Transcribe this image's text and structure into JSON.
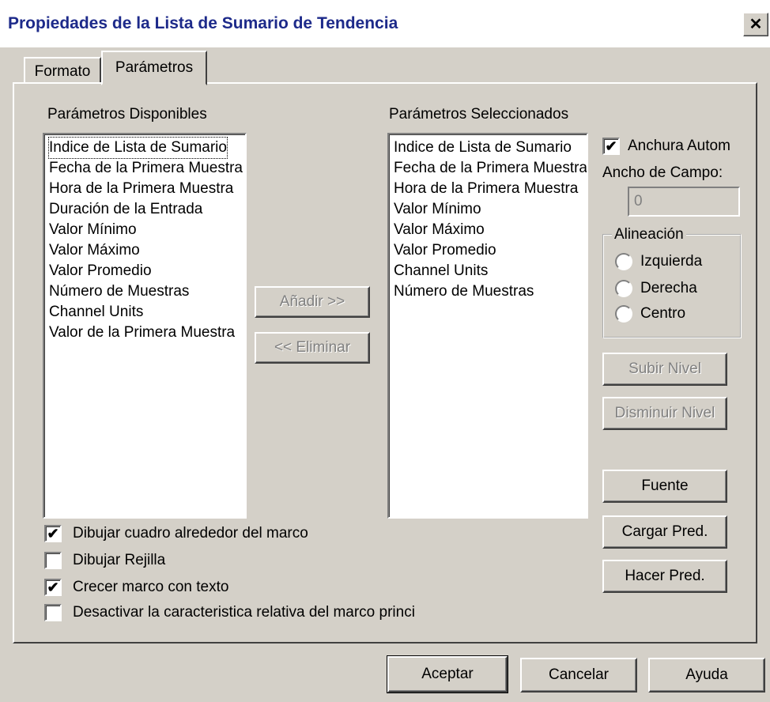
{
  "window": {
    "title": "Propiedades de la Lista de Sumario de Tendencia",
    "close_glyph": "✕"
  },
  "tabs": [
    {
      "label": "Formato"
    },
    {
      "label": "Parámetros"
    }
  ],
  "available": {
    "label": "Parámetros Disponibles",
    "items": [
      "Indice de Lista de Sumario",
      "Fecha de la Primera Muestra",
      "Hora de la Primera Muestra",
      "Duración de la Entrada",
      "Valor Mínimo",
      "Valor Máximo",
      "Valor Promedio",
      "Número de Muestras",
      "Channel Units",
      "Valor de la Primera Muestra"
    ]
  },
  "selected": {
    "label": "Parámetros Seleccionados",
    "items": [
      "Indice de Lista de Sumario",
      "Fecha de la Primera Muestra",
      "Hora de la Primera Muestra",
      "Valor Mínimo",
      "Valor Máximo",
      "Valor Promedio",
      "Channel Units",
      "Número de Muestras"
    ]
  },
  "buttons": {
    "add": "Añadir >>",
    "remove": "<< Eliminar",
    "move_up": "Subir Nivel",
    "move_down": "Disminuir Nivel",
    "font": "Fuente",
    "load_default": "Cargar Pred.",
    "make_default": "Hacer Pred.",
    "ok": "Aceptar",
    "cancel": "Cancelar",
    "help": "Ayuda"
  },
  "auto_width": {
    "label": "Anchura Autom",
    "checked": true
  },
  "field_width": {
    "label": "Ancho de Campo:",
    "value": "0"
  },
  "alignment": {
    "label": "Alineación",
    "options": [
      "Izquierda",
      "Derecha",
      "Centro"
    ]
  },
  "checkboxes": [
    {
      "label": "Dibujar cuadro alrededor del marco",
      "checked": true
    },
    {
      "label": "Dibujar Rejilla",
      "checked": false
    },
    {
      "label": "Crecer marco con texto",
      "checked": true
    },
    {
      "label": "Desactivar la caracteristica relativa del marco princi",
      "checked": false
    }
  ],
  "check_glyph": "✔"
}
